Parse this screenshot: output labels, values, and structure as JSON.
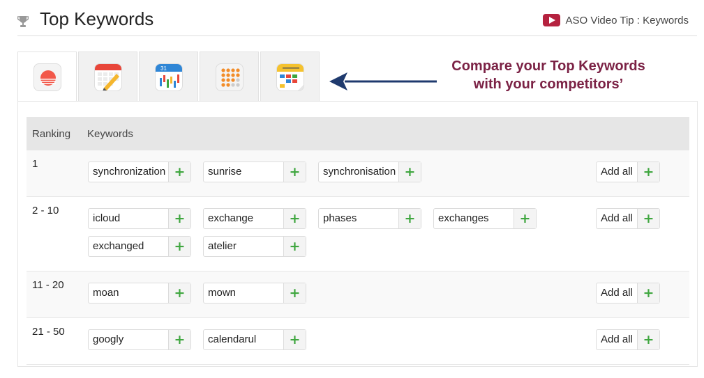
{
  "header": {
    "title": "Top Keywords",
    "trophy_icon": "trophy-icon",
    "video_tip_label": "ASO Video Tip : Keywords",
    "video_icon": "youtube-play-icon"
  },
  "tabs": [
    {
      "icon": "sunrise-app-icon",
      "active": true
    },
    {
      "icon": "calendar-pencil-app-icon",
      "active": false
    },
    {
      "icon": "calendar-chart-app-icon",
      "active": false
    },
    {
      "icon": "dots-grid-app-icon",
      "active": false
    },
    {
      "icon": "calendar-blocks-app-icon",
      "active": false
    }
  ],
  "annotation": {
    "line1": "Compare your Top Keywords",
    "line2": "with your competitors’",
    "color": "#7b2245",
    "arrow_color": "#1f3a6e"
  },
  "table": {
    "col_ranking": "Ranking",
    "col_keywords": "Keywords",
    "add_all_label": "Add all",
    "plus": "+",
    "rows": [
      {
        "rank": "1",
        "keywords": [
          "synchronization",
          "sunrise",
          "synchronisation"
        ]
      },
      {
        "rank": "2 - 10",
        "keywords": [
          "icloud",
          "exchange",
          "phases",
          "exchanges",
          "exchanged",
          "atelier"
        ]
      },
      {
        "rank": "11 - 20",
        "keywords": [
          "moan",
          "mown"
        ]
      },
      {
        "rank": "21 - 50",
        "keywords": [
          "googly",
          "calendarul"
        ]
      }
    ]
  }
}
